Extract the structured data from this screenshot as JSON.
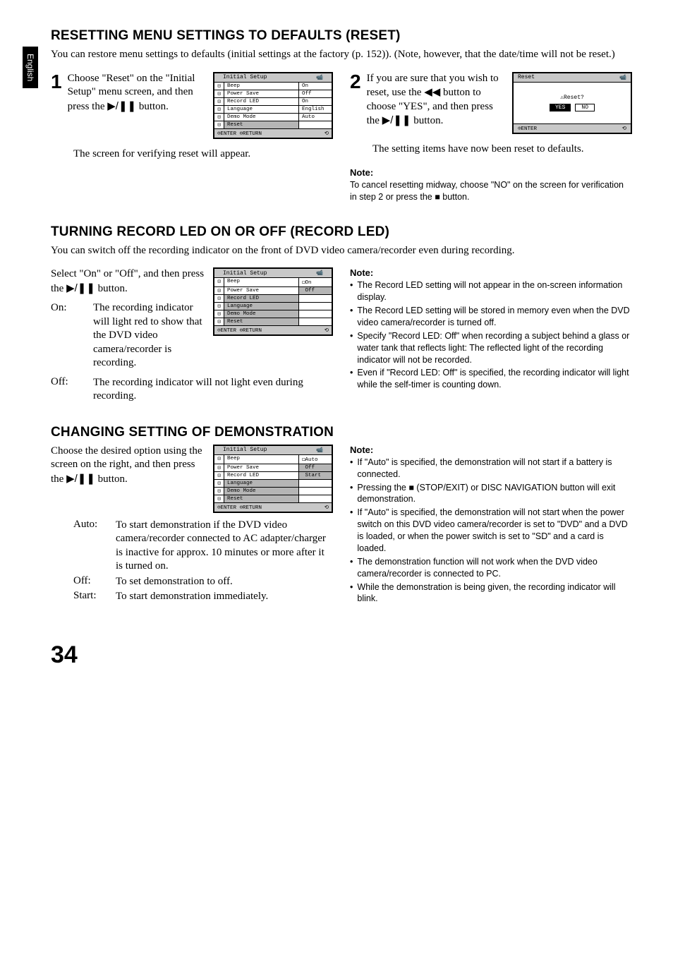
{
  "side_tab": "English",
  "page_number": "34",
  "s1": {
    "heading": "RESETTING MENU SETTINGS TO DEFAULTS (RESET)",
    "intro": "You can restore menu settings to defaults (initial settings at the factory (p. 152)). (Note, however, that the date/time will not be reset.)",
    "step1_num": "1",
    "step1_text_a": "Choose \"Reset\" on the \"Initial Setup\" menu screen, and then press the ",
    "step1_text_b": " button.",
    "step1_follow": "The screen for verifying reset will appear.",
    "step2_num": "2",
    "step2_text_a": "If you are sure that you wish to reset, use the ",
    "step2_text_b": " button to choose \"YES\", and then press the ",
    "step2_text_c": " button.",
    "step2_follow": "The setting items have now been reset to defaults.",
    "note_heading": "Note:",
    "note_text_a": "To cancel resetting midway, choose \"NO\" on the screen for verification in step 2 or press the ",
    "note_text_b": " button.",
    "screen1": {
      "title": "Initial Setup",
      "rows": [
        {
          "label": "Beep",
          "val": "On"
        },
        {
          "label": "Power Save",
          "val": "Off"
        },
        {
          "label": "Record LED",
          "val": "On"
        },
        {
          "label": "Language",
          "val": "English"
        },
        {
          "label": "Demo Mode",
          "val": "Auto"
        },
        {
          "label": "Reset",
          "val": "",
          "hl": true
        }
      ],
      "foot_l": "⊙ENTER  ⊙RETURN",
      "foot_r": "⟲"
    },
    "reset_screen": {
      "title": "Reset",
      "q": "⚠Reset?",
      "yes": "YES",
      "no": "NO",
      "foot_l": "⊙ENTER",
      "foot_r": "⟲"
    }
  },
  "s2": {
    "heading": "TURNING RECORD LED ON OR OFF (RECORD LED)",
    "intro": "You can switch off the recording indicator on the front of DVD video camera/recorder even during recording.",
    "lead_a": "Select \"On\" or \"Off\", and then press the ",
    "lead_b": " button.",
    "on_label": "On:",
    "on_text": "The recording indicator will light red to show that the DVD video camera/recorder is recording.",
    "off_label": "Off:",
    "off_text": "The recording indicator will not light even during recording.",
    "note_heading": "Note:",
    "n1": "The Record LED setting will not appear in the on-screen information display.",
    "n2": "The Record LED setting will be stored in memory even when the DVD video camera/recorder is turned off.",
    "n3": "Specify \"Record LED: Off\" when recording a subject behind a glass or water tank that reflects light: The reflected light of the recording indicator will not be recorded.",
    "n4": "Even if \"Record LED: Off\" is specified, the recording indicator will light while the self-timer is counting down.",
    "screen": {
      "title": "Initial Setup",
      "rows": [
        {
          "label": "Beep",
          "val": "◻On"
        },
        {
          "label": "Power Save",
          "val": " Off",
          "vhl": true
        },
        {
          "label": "Record LED",
          "val": "",
          "hl": true
        },
        {
          "label": "Language",
          "val": "",
          "hl": true
        },
        {
          "label": "Demo Mode",
          "val": "",
          "hl": true
        },
        {
          "label": "Reset",
          "val": "",
          "hl": true
        }
      ],
      "foot_l": "⊙ENTER  ⊙RETURN",
      "foot_r": "⟲"
    }
  },
  "s3": {
    "heading": "CHANGING SETTING OF DEMONSTRATION",
    "lead_a": "Choose the desired option using the screen on the right, and then press the ",
    "lead_b": " button.",
    "auto_label": "Auto:",
    "auto_text": "To start demonstration if the DVD video camera/recorder connected to AC adapter/charger is inactive for approx. 10 minutes or more after it is turned on.",
    "off_label": "Off:",
    "off_text": "To set demonstration to off.",
    "start_label": "Start:",
    "start_text": "To start demonstration immediately.",
    "note_heading": "Note:",
    "n1": "If \"Auto\" is specified, the demonstration will not start if a battery is connected.",
    "n2_a": "Pressing the ",
    "n2_b": " (STOP/EXIT) or DISC NAVIGATION button will exit demonstration.",
    "n3": "If \"Auto\" is specified, the demonstration will not start when the power switch on this DVD video camera/recorder is set to \"DVD\" and a DVD is loaded, or when the power switch is set to \"SD\" and a card is loaded.",
    "n4": "The demonstration function will not work when the DVD video camera/recorder is connected to PC.",
    "n5": "While the demonstration is being given, the recording indicator will blink.",
    "screen": {
      "title": "Initial Setup",
      "rows": [
        {
          "label": "Beep",
          "val": "◻Auto"
        },
        {
          "label": "Power Save",
          "val": " Off",
          "vhl": true
        },
        {
          "label": "Record LED",
          "val": " Start",
          "vhl": true
        },
        {
          "label": "Language",
          "val": "",
          "hl": true
        },
        {
          "label": "Demo Mode",
          "val": "",
          "hl": true
        },
        {
          "label": "Reset",
          "val": "",
          "hl": true
        }
      ],
      "foot_l": "⊙ENTER  ⊙RETURN",
      "foot_r": "⟲"
    }
  },
  "icons": {
    "play_pause": "▶/❚❚",
    "rewind": "◀◀",
    "stop": "■",
    "camera": "📹"
  }
}
